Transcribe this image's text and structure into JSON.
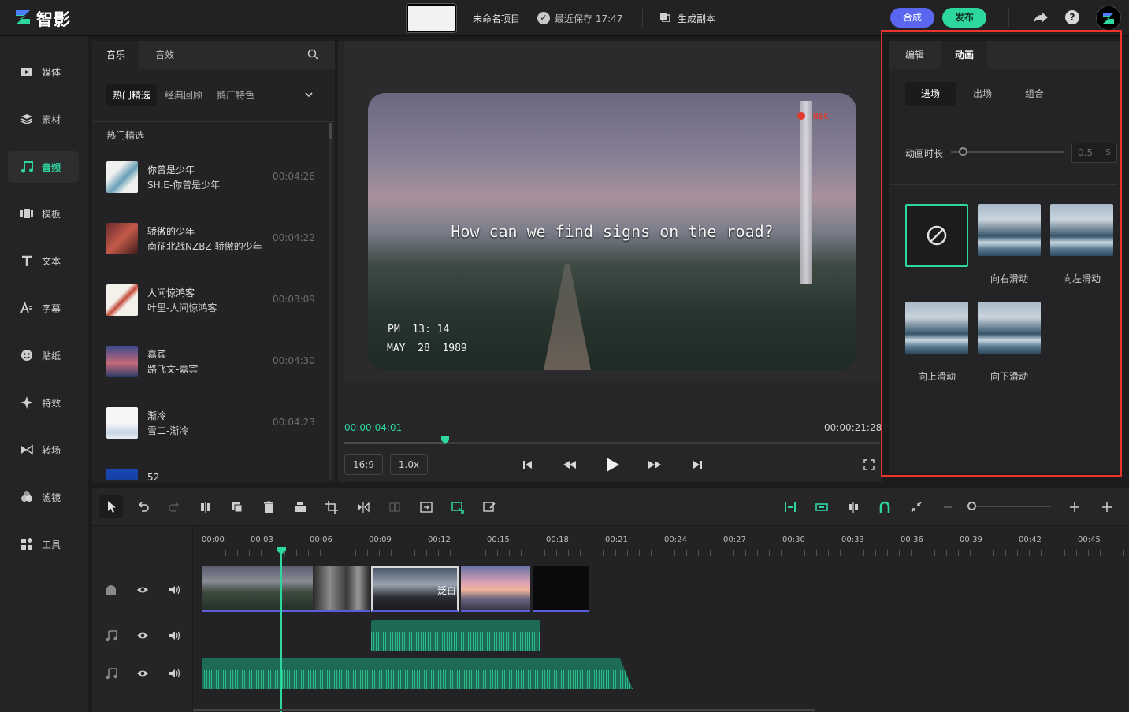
{
  "app": {
    "logo_text": "智影",
    "project_name": "未命名项目",
    "save_status": "最近保存 17:47",
    "copy_label": "生成副本",
    "compose_label": "合成",
    "publish_label": "发布"
  },
  "colors": {
    "accent": "#2ed6a0",
    "compose": "#5a66f0",
    "highlight": "#e8352b"
  },
  "leftnav": {
    "items": [
      {
        "label": "媒体",
        "icon": "film-icon"
      },
      {
        "label": "素材",
        "icon": "layers-icon"
      },
      {
        "label": "音频",
        "icon": "music-note-icon",
        "active": true
      },
      {
        "label": "模板",
        "icon": "template-icon"
      },
      {
        "label": "文本",
        "icon": "text-icon"
      },
      {
        "label": "字幕",
        "icon": "subtitle-icon"
      },
      {
        "label": "贴纸",
        "icon": "smiley-icon"
      },
      {
        "label": "特效",
        "icon": "sparkle-icon"
      },
      {
        "label": "转场",
        "icon": "transition-icon"
      },
      {
        "label": "滤镜",
        "icon": "filter-icon"
      },
      {
        "label": "工具",
        "icon": "tools-icon"
      }
    ]
  },
  "music": {
    "tabs": [
      "音乐",
      "音效"
    ],
    "subtabs": [
      "热门精选",
      "经典回顾",
      "鹅厂特色"
    ],
    "section_title": "热门精选",
    "tracks": [
      {
        "name": "你曾是少年",
        "artist": "SH.E-你曾是少年",
        "duration": "00:04:26"
      },
      {
        "name": "骄傲的少年",
        "artist": "南征北战NZBZ-骄傲的少年",
        "duration": "00:04:22"
      },
      {
        "name": "人间惊鸿客",
        "artist": "叶里-人间惊鸿客",
        "duration": "00:03:09"
      },
      {
        "name": "嘉宾",
        "artist": "路飞文-嘉宾",
        "duration": "00:04:30"
      },
      {
        "name": "渐冷",
        "artist": "雪二-渐冷",
        "duration": "00:04:23"
      },
      {
        "name": "52",
        "artist": "",
        "duration": ""
      }
    ]
  },
  "preview": {
    "rec_label": "REC",
    "caption": "How can we find signs on the road?",
    "ts_time": "PM  13: 14",
    "ts_date": "MAY  28  1989",
    "current_time": "00:00:04:01",
    "total_time": "00:00:21:28",
    "progress": 0.188,
    "aspect_label": "16:9",
    "speed_label": "1.0x"
  },
  "inspector": {
    "tabs": [
      "编辑",
      "动画"
    ],
    "active_tab": "动画",
    "subtabs": [
      "进场",
      "出场",
      "组合"
    ],
    "duration_label": "动画时长",
    "duration_value": "0.5",
    "duration_unit": "S",
    "animations": [
      {
        "label": "向右滑动"
      },
      {
        "label": "向左滑动"
      },
      {
        "label": "向上滑动"
      },
      {
        "label": "向下滑动"
      }
    ]
  },
  "timeline": {
    "ruler": [
      "00:00",
      "00:03",
      "00:06",
      "00:09",
      "00:12",
      "00:15",
      "00:18",
      "00:21",
      "00:24",
      "00:27",
      "00:30",
      "00:33",
      "00:36",
      "00:39",
      "00:42",
      "00:45"
    ],
    "clip3_text": "泛白"
  }
}
